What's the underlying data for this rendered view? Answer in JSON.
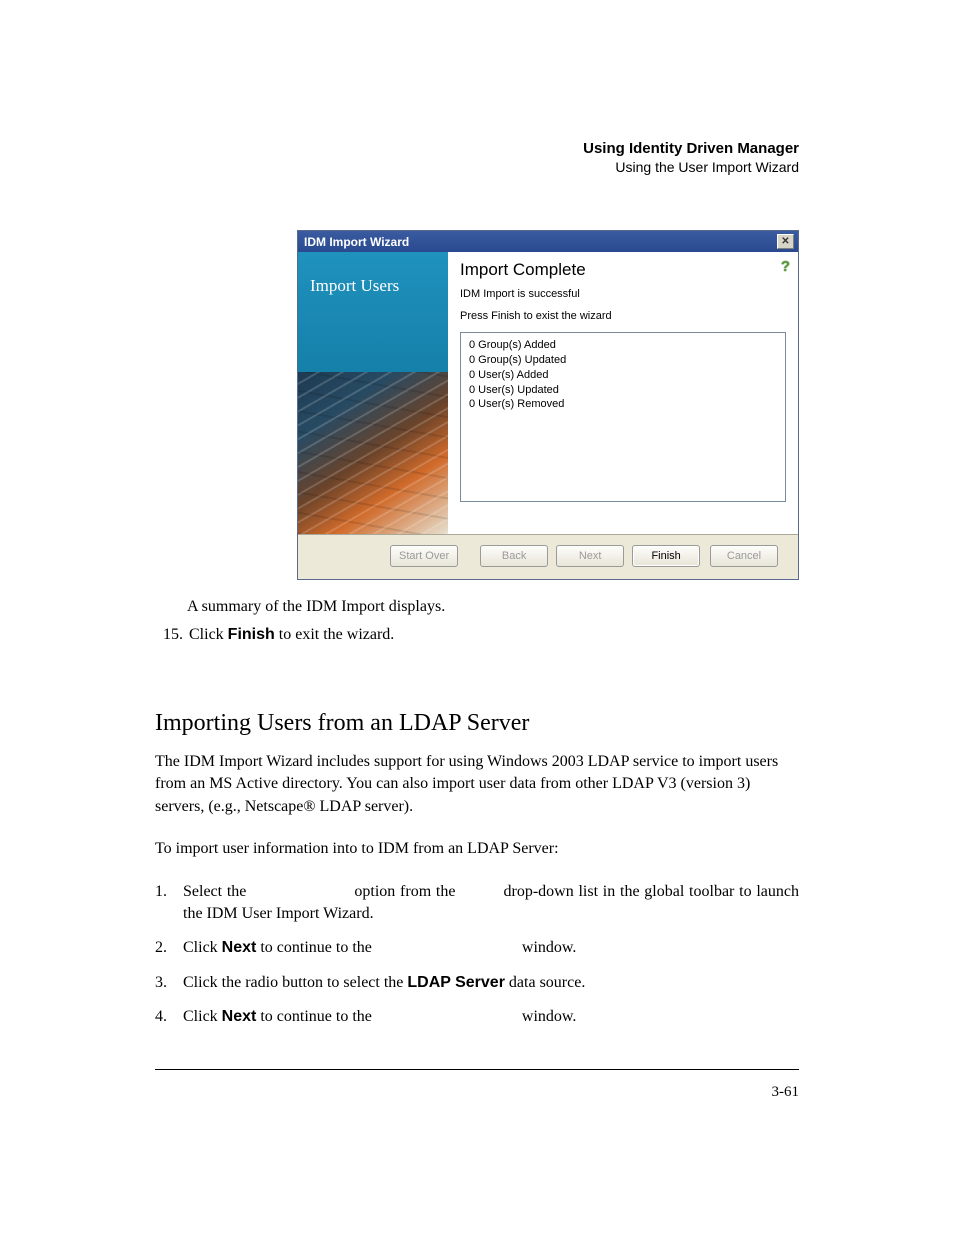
{
  "header": {
    "bold": "Using Identity Driven Manager",
    "sub": "Using the User Import Wizard"
  },
  "dialog": {
    "title": "IDM Import Wizard",
    "close_glyph": "✕",
    "side_title": "Import Users",
    "content_title": "Import Complete",
    "help_glyph": "?",
    "status_line": "IDM Import is successful",
    "instruct_line": "Press Finish to exist the wizard",
    "summary": [
      "0 Group(s) Added",
      "0 Group(s) Updated",
      "0 User(s) Added",
      "0 User(s) Updated",
      "0 User(s) Removed"
    ],
    "buttons": {
      "start_over": "Start Over",
      "back": "Back",
      "next": "Next",
      "finish": "Finish",
      "cancel": "Cancel"
    }
  },
  "caption": "A summary of the IDM Import displays.",
  "step15_num": "15.",
  "step15_pre": "Click ",
  "step15_bold": "Finish",
  "step15_post": " to exit the wizard.",
  "section_heading": "Importing Users from an LDAP Server",
  "para1": "The IDM Import Wizard includes support for using Windows 2003 LDAP service to import users from an MS Active directory. You can also import user data from other LDAP V3 (version 3) servers, (e.g., Netscape® LDAP server).",
  "para2": "To import user information into to IDM from an LDAP Server:",
  "steps": {
    "s1_num": "1.",
    "s1a": "Select the",
    "s1b": "option from the",
    "s1c": "drop-down list in the global toolbar to launch the IDM User Import Wizard.",
    "s2_num": "2.",
    "s2_pre": "Click ",
    "s2_bold": "Next",
    "s2_mid": " to continue to the",
    "s2_post": "window.",
    "s3_num": "3.",
    "s3_pre": "Click the radio button to select the ",
    "s3_bold": "LDAP Server",
    "s3_post": " data source.",
    "s4_num": "4.",
    "s4_pre": "Click ",
    "s4_bold": "Next",
    "s4_mid": " to continue to the",
    "s4_post": "window."
  },
  "page_number": "3-61"
}
